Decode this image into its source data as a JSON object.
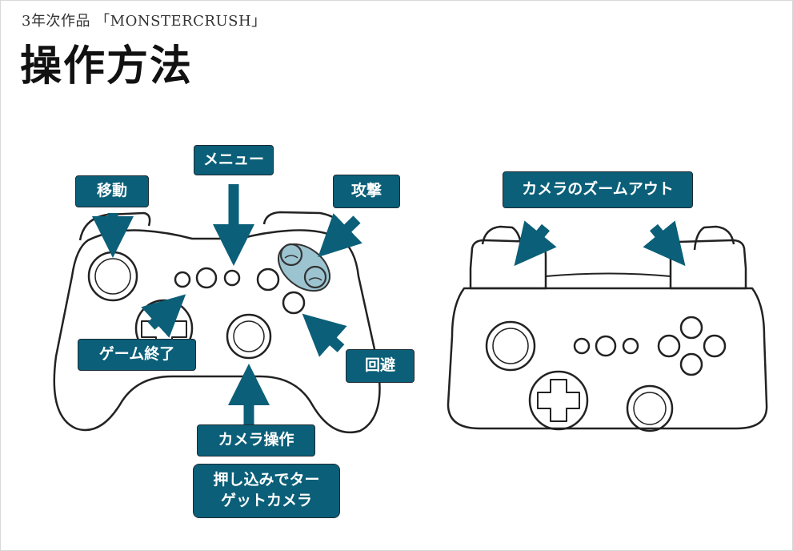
{
  "header": {
    "subtitle": "3年次作品 「MONSTERCRUSH」",
    "title": "操作方法"
  },
  "labels": {
    "move": "移動",
    "menu": "メニュー",
    "attack": "攻撃",
    "quit_game": "ゲーム終了",
    "dodge": "回避",
    "camera": "カメラ操作",
    "push_target_line1": "押し込みでター",
    "push_target_line2": "ゲットカメラ",
    "zoom_out": "カメラのズームアウト"
  },
  "colors": {
    "label_bg": "#0b5f78",
    "arrow": "#0b5f78",
    "highlight": "#9cc4d0"
  }
}
